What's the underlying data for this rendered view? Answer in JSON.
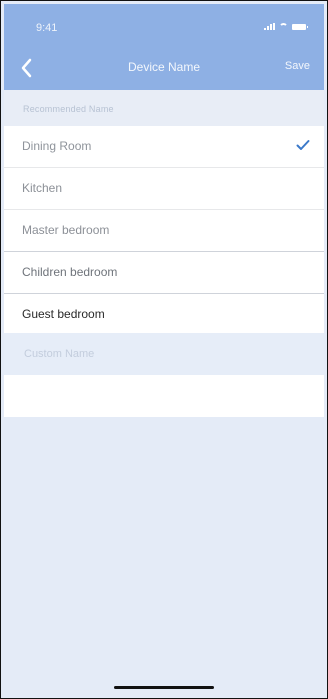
{
  "status_bar": {
    "time": "9:41",
    "icons": [
      "signal-icon",
      "wifi-icon",
      "battery-icon"
    ]
  },
  "nav": {
    "back_icon": "chevron-left-icon",
    "title": "Device Name",
    "save_label": "Save"
  },
  "section": {
    "title": "Recommended Name"
  },
  "recommended_names": [
    {
      "label": "Dining Room",
      "selected": true
    },
    {
      "label": "Kitchen",
      "selected": false
    },
    {
      "label": "Master bedroom",
      "selected": false
    },
    {
      "label": "Children bedroom",
      "selected": false
    },
    {
      "label": "Guest bedroom",
      "selected": false
    }
  ],
  "custom_name": {
    "placeholder": "Custom Name",
    "value": ""
  },
  "colors": {
    "header": "#8eb0e4",
    "accent": "#3b79c9",
    "background": "#e4ebf7"
  }
}
